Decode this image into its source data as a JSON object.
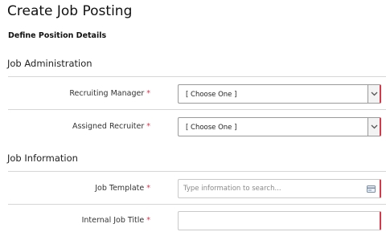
{
  "page": {
    "title": "Create Job Posting",
    "subtitle": "Define Position Details"
  },
  "sections": [
    {
      "title": "Job Administration",
      "fields": [
        {
          "label": "Recruiting Manager",
          "required_mark": "*",
          "type": "select",
          "value": "[ Choose One ]"
        },
        {
          "label": "Assigned Recruiter",
          "required_mark": "*",
          "type": "select",
          "value": "[ Choose One ]"
        }
      ]
    },
    {
      "title": "Job Information",
      "fields": [
        {
          "label": "Job Template",
          "required_mark": "*",
          "type": "search",
          "value": "",
          "placeholder": "Type information to search..."
        },
        {
          "label": "Internal Job Title",
          "required_mark": "*",
          "type": "text",
          "value": ""
        }
      ]
    }
  ],
  "colors": {
    "required": "#e3324a",
    "required_border": "#d23a4c",
    "divider": "#d6d6d6"
  },
  "icons": {
    "select_toggle": "chevron-down-icon",
    "search_lookup": "card-icon"
  }
}
